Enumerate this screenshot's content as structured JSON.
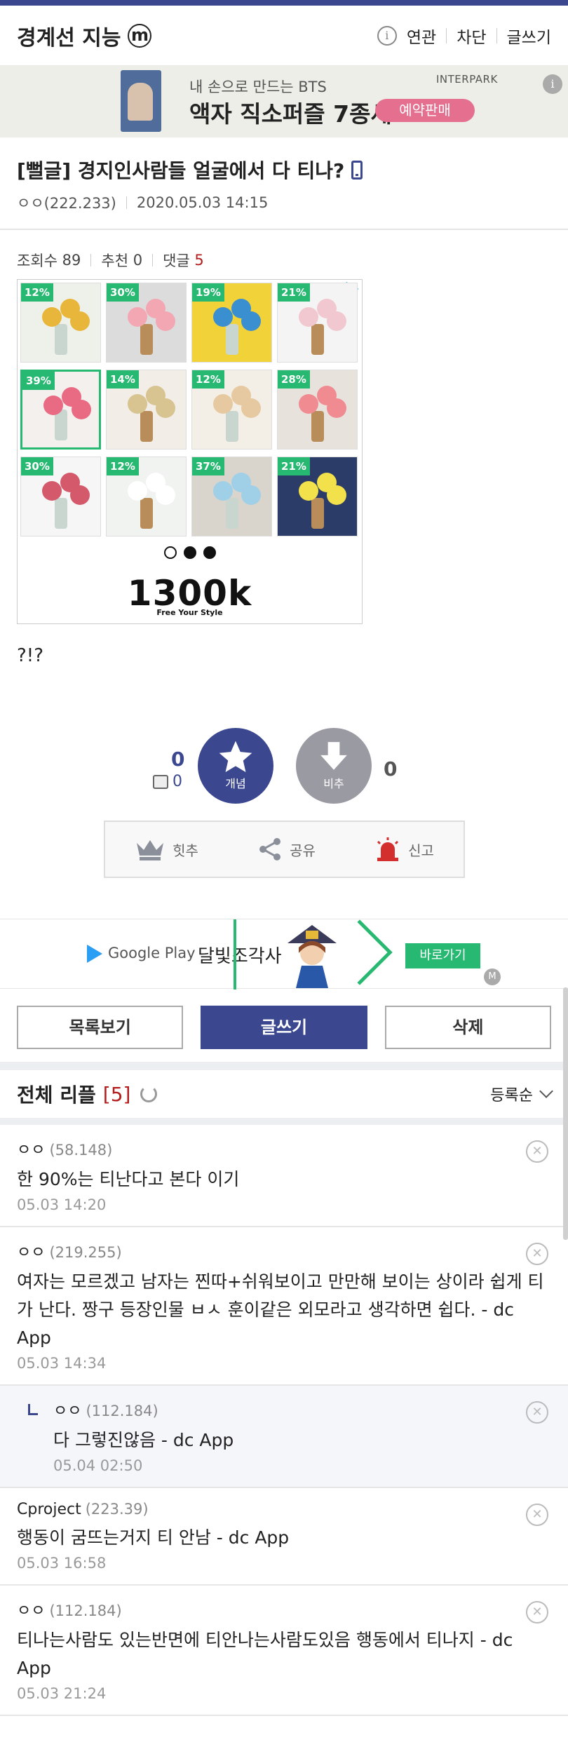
{
  "header": {
    "gallery_name": "경계선 지능",
    "gallery_badge": "m",
    "menu": [
      "연관",
      "차단",
      "글쓰기"
    ]
  },
  "top_banner": {
    "line1": "내 손으로 만드는 BTS",
    "line2": "액자 직소퍼즐 7종세트",
    "button": "예약판매",
    "logo": "INTERPARK"
  },
  "post": {
    "title": "[뻘글] 경지인사람들 얼굴에서 다 티나?",
    "author": "ㅇㅇ(222.233)",
    "date": "2020.05.03 14:15",
    "views_label": "조회수",
    "views": "89",
    "recommend_label": "추천",
    "recommend": "0",
    "comments_label": "댓글",
    "comments": "5",
    "body": "?!?"
  },
  "ad": {
    "tiles": [
      "12%",
      "30%",
      "19%",
      "21%",
      "39%",
      "14%",
      "12%",
      "28%",
      "30%",
      "12%",
      "37%",
      "21%"
    ],
    "logo": "1300k",
    "tagline": "Free Your Style"
  },
  "votes": {
    "up_count": "0",
    "fix_count": "0",
    "up_label": "개념",
    "down_label": "비추",
    "down_count": "0"
  },
  "actions": {
    "hit": "힛추",
    "share": "공유",
    "report": "신고"
  },
  "game_banner": {
    "store": "Google Play",
    "name": "달빛조각사",
    "button": "바로가기",
    "mark": "M"
  },
  "buttons": {
    "list": "목록보기",
    "write": "글쓰기",
    "delete": "삭제"
  },
  "comments_header": {
    "title": "전체 리플",
    "count": "[5]",
    "sort": "등록순"
  },
  "comments": [
    {
      "nick": "ㅇㅇ",
      "ip": "(58.148)",
      "text": "한 90%는 티난다고 본다 이기",
      "time": "05.03 14:20"
    },
    {
      "nick": "ㅇㅇ",
      "ip": "(219.255)",
      "text": "여자는 모르겠고 남자는 찐따+쉬워보이고 만만해 보이는 상이라 쉽게 티가 난다. 짱구 등장인물 ㅂㅅ 훈이같은 외모라고 생각하면 쉽다. - dc App",
      "time": "05.03 14:34"
    },
    {
      "nick": "ㅇㅇ",
      "ip": "(112.184)",
      "text": "다 그렇진않음 - dc App",
      "time": "05.04 02:50"
    },
    {
      "nick": "Cproject",
      "ip": "(223.39)",
      "text": "행동이 굼뜨는거지 티 안남 - dc App",
      "time": "05.03 16:58"
    },
    {
      "nick": "ㅇㅇ",
      "ip": "(112.184)",
      "text": "티나는사람도 있는반면에 티안나는사람도있음 행동에서 티나지 - dc App",
      "time": "05.03 21:24"
    }
  ],
  "colors": {
    "brand": "#3b4890",
    "accent_red": "#b41d1d",
    "ad_green": "#27b871"
  }
}
